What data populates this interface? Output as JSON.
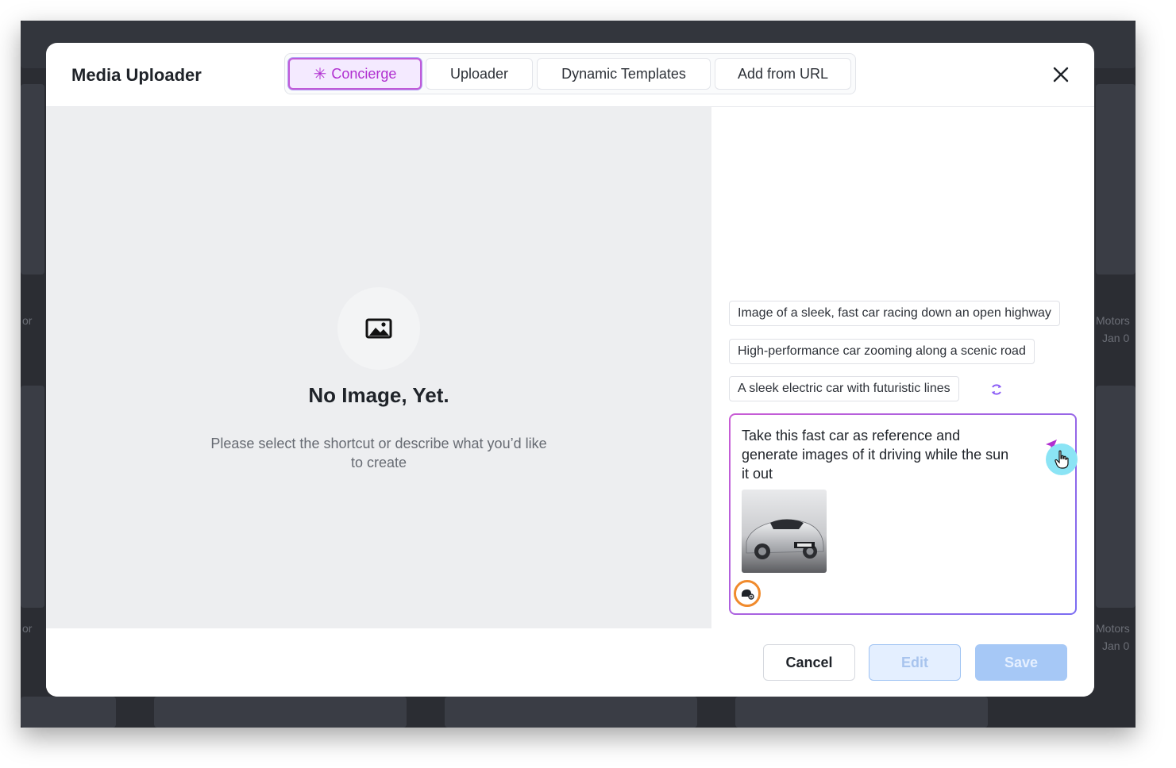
{
  "background": {
    "labels": [
      "or",
      "Motors",
      "Jan 0",
      "or",
      "Motors",
      "Jan 0"
    ]
  },
  "modal": {
    "title": "Media Uploader",
    "close_icon": "close-icon"
  },
  "tabs": [
    {
      "label": "Concierge",
      "icon": "sparkle-icon",
      "active": true
    },
    {
      "label": "Uploader",
      "active": false
    },
    {
      "label": "Dynamic Templates",
      "active": false
    },
    {
      "label": "Add from URL",
      "active": false
    }
  ],
  "empty_state": {
    "icon": "image-icon",
    "title": "No Image, Yet.",
    "subtitle": "Please select the shortcut or describe what you’d like to create"
  },
  "suggestions": [
    "Image of a sleek, fast car racing down an open highway",
    "High-performance car zooming along a scenic road",
    "A sleek electric car with futuristic lines"
  ],
  "prompt": {
    "text": "Take this fast car as reference and generate images of it driving while the sun it out",
    "reference_image": "silver sports car photo",
    "send_icon": "send-icon",
    "attach_icon": "image-attach-icon"
  },
  "footer": {
    "cancel_label": "Cancel",
    "edit_label": "Edit",
    "save_label": "Save"
  },
  "colors": {
    "accent": "#b02fd0",
    "primary_disabled": "#a6c8f6",
    "highlight_ring": "#f08a2c"
  }
}
